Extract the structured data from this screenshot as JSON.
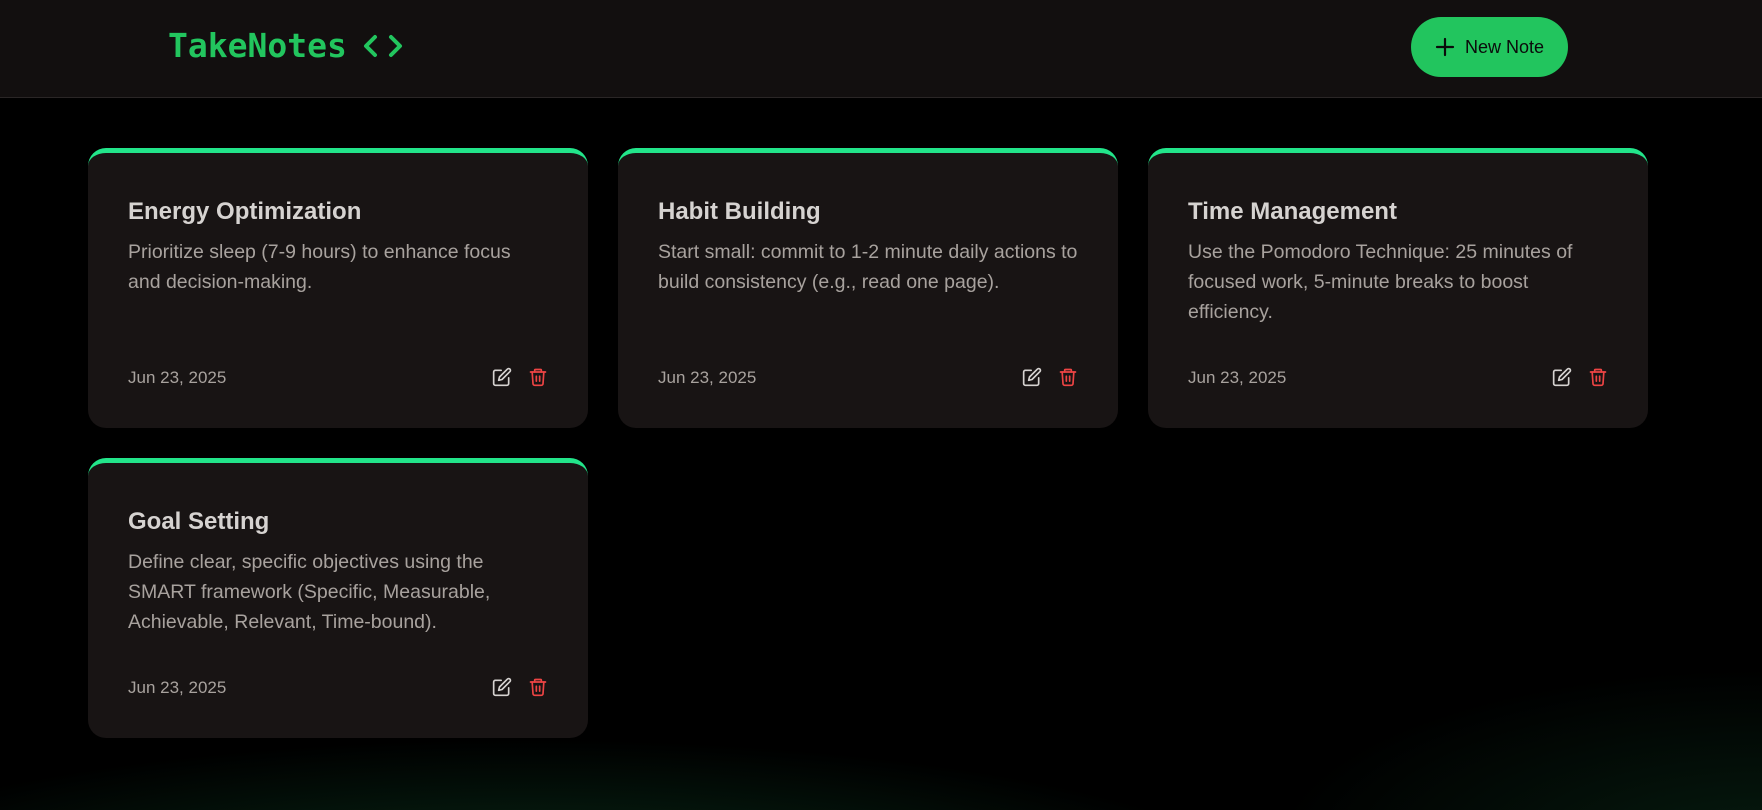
{
  "app": {
    "brand": "TakeNotes",
    "accent": "#22c55e",
    "card_accent": "#22e58a",
    "delete_color": "#ef4444"
  },
  "header": {
    "brand_icon": "code-icon",
    "new_note_label": "New Note",
    "new_note_icon": "plus-icon"
  },
  "notes": [
    {
      "title": "Energy Optimization",
      "body": "Prioritize sleep (7-9 hours) to enhance focus and decision-making.",
      "date": "Jun 23, 2025"
    },
    {
      "title": "Habit Building",
      "body": "Start small: commit to 1-2 minute daily actions to build consistency (e.g., read one page).",
      "date": "Jun 23, 2025"
    },
    {
      "title": "Time Management",
      "body": "Use the Pomodoro Technique: 25 minutes of focused work, 5-minute breaks to boost efficiency.",
      "date": "Jun 23, 2025"
    },
    {
      "title": "Goal Setting",
      "body": "Define clear, specific objectives using the SMART framework (Specific, Measurable, Achievable, Relevant, Time-bound).",
      "date": "Jun 23, 2025"
    }
  ]
}
